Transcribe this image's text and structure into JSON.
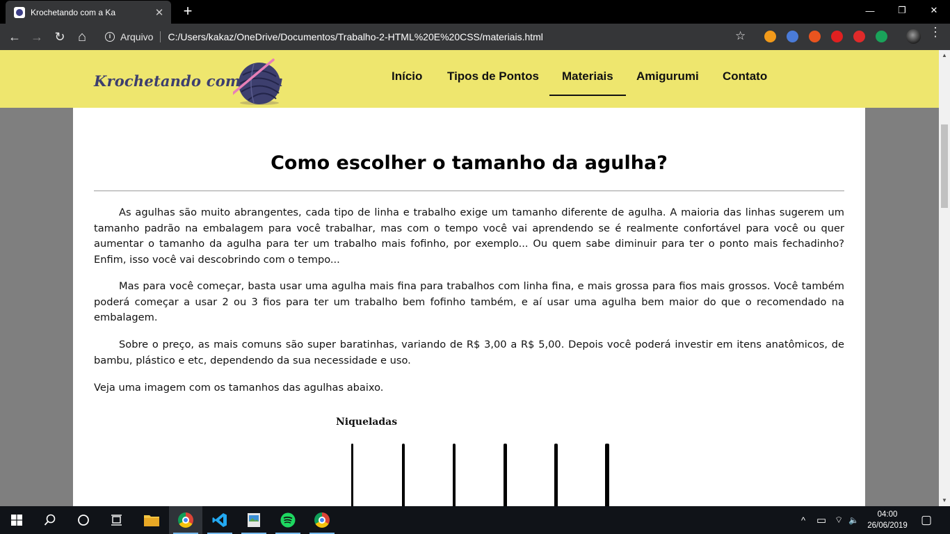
{
  "browser": {
    "tab_title": "Krochetando com a Ka",
    "tab_close": "✕",
    "new_tab": "+",
    "window_controls": {
      "minimize": "—",
      "maximize": "❐",
      "close": "✕"
    },
    "nav": {
      "back": "←",
      "forward": "→",
      "reload": "↻",
      "home": "⌂"
    },
    "security_label": "Arquivo",
    "url": "C:/Users/kakaz/OneDrive/Documentos/Trabalho-2-HTML%20E%20CSS/materiais.html",
    "bookmark_icon": "☆",
    "menu_icon": "⋮",
    "extensions": [
      {
        "name": "play-extension-icon",
        "color": "#f29a1a"
      },
      {
        "name": "translate-extension-icon",
        "color": "#4a7bd8"
      },
      {
        "name": "fire-extension-icon",
        "color": "#e9541f"
      },
      {
        "name": "adblock-extension-icon",
        "color": "#e02020"
      },
      {
        "name": "youtube-extension-icon",
        "color": "#e02a2a"
      },
      {
        "name": "map-pin-extension-icon",
        "color": "#1aa35a"
      }
    ]
  },
  "site": {
    "logo_text": "Krochetando com a Ka",
    "nav": [
      {
        "label": "Início",
        "active": false
      },
      {
        "label": "Tipos de Pontos",
        "active": false
      },
      {
        "label": "Materiais",
        "active": true
      },
      {
        "label": "Amigurumi",
        "active": false
      },
      {
        "label": "Contato",
        "active": false
      }
    ],
    "colors": {
      "header_bg": "#eee66e",
      "yarn": "#3d3f6e",
      "hook": "#e87fb6"
    }
  },
  "article": {
    "title": "Como escolher o tamanho da agulha?",
    "paragraphs": [
      "As agulhas são muito abrangentes, cada tipo de linha e trabalho exige um tamanho diferente de agulha. A maioria das linhas sugerem um tamanho padrão na embalagem para você trabalhar, mas com o tempo você vai aprendendo se é realmente confortável para você ou quer aumentar o tamanho da agulha para ter um trabalho mais fofinho, por exemplo... Ou quem sabe diminuir para ter o ponto mais fechadinho? Enfim, isso você vai descobrindo com o tempo...",
      "Mas para você começar, basta usar uma agulha mais fina para trabalhos com linha fina, e mais grossa para fios mais grossos. Você também poderá começar a usar 2 ou 3 fios para ter um trabalho bem fofinho também, e aí usar uma agulha bem maior do que o recomendado na embalagem.",
      "Sobre o preço, as mais comuns são super baratinhas, variando de R$ 3,00 a R$ 5,00. Depois você poderá investir em itens anatômicos, de bambu, plástico e etc, dependendo da sua necessidade e uso.",
      "Veja uma imagem com os tamanhos das agulhas abaixo."
    ],
    "image_label": "Niqueladas"
  },
  "taskbar": {
    "apps": [
      {
        "name": "start-button",
        "glyph": ""
      },
      {
        "name": "search-icon",
        "glyph": "⌕"
      },
      {
        "name": "cortana-icon",
        "glyph": "○"
      },
      {
        "name": "task-view-icon",
        "glyph": "☷"
      },
      {
        "name": "file-explorer-icon",
        "glyph": ""
      },
      {
        "name": "chrome-taskbar-icon",
        "glyph": ""
      },
      {
        "name": "vscode-icon",
        "glyph": ""
      },
      {
        "name": "photos-icon",
        "glyph": ""
      },
      {
        "name": "spotify-icon",
        "glyph": ""
      },
      {
        "name": "chrome-taskbar-icon-2",
        "glyph": ""
      }
    ],
    "tray": {
      "chevron": "^",
      "battery": "▭",
      "wifi": "⌔",
      "volume": "🔈",
      "notifications": "▢"
    },
    "time": "04:00",
    "date": "26/06/2019"
  }
}
